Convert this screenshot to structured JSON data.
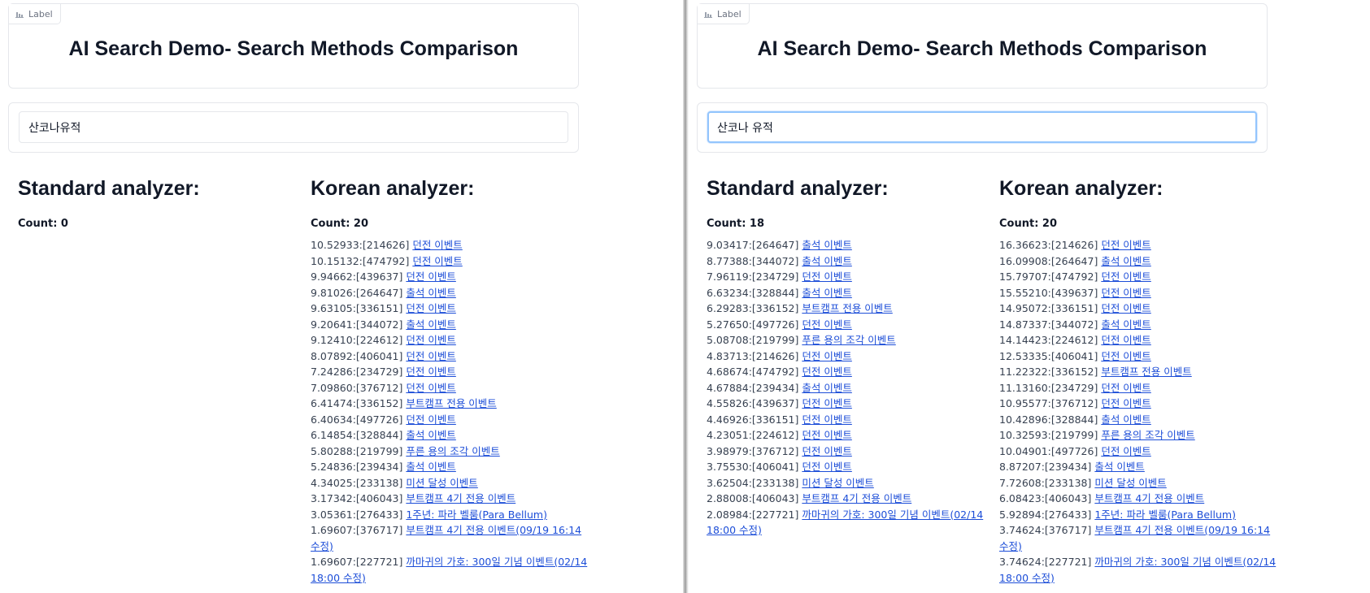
{
  "label_chip": "Label",
  "title": "AI Search Demo- Search Methods Comparison",
  "left": {
    "query": "산코나유적",
    "standard": {
      "heading": "Standard analyzer:",
      "count": "Count: 0",
      "results": []
    },
    "korean": {
      "heading": "Korean analyzer:",
      "count": "Count: 20",
      "results": [
        {
          "score": "10.52933:[214626]",
          "link": "던전 이벤트"
        },
        {
          "score": "10.15132:[474792]",
          "link": "던전 이벤트"
        },
        {
          "score": "9.94662:[439637]",
          "link": "던전 이벤트"
        },
        {
          "score": "9.81026:[264647]",
          "link": "출석 이벤트"
        },
        {
          "score": "9.63105:[336151]",
          "link": "던전 이벤트"
        },
        {
          "score": "9.20641:[344072]",
          "link": "출석 이벤트"
        },
        {
          "score": "9.12410:[224612]",
          "link": "던전 이벤트"
        },
        {
          "score": "8.07892:[406041]",
          "link": "던전 이벤트"
        },
        {
          "score": "7.24286:[234729]",
          "link": "던전 이벤트"
        },
        {
          "score": "7.09860:[376712]",
          "link": "던전 이벤트"
        },
        {
          "score": "6.41474:[336152]",
          "link": "부트캠프 전용 이벤트"
        },
        {
          "score": "6.40634:[497726]",
          "link": "던전 이벤트"
        },
        {
          "score": "6.14854:[328844]",
          "link": "출석 이벤트"
        },
        {
          "score": "5.80288:[219799]",
          "link": "푸른 용의 조각 이벤트"
        },
        {
          "score": "5.24836:[239434]",
          "link": "출석 이벤트"
        },
        {
          "score": "4.34025:[233138]",
          "link": "미션 달성 이벤트"
        },
        {
          "score": "3.17342:[406043]",
          "link": "부트캠프 4기 전용 이벤트"
        },
        {
          "score": "3.05361:[276433]",
          "link": "1주년: 파라 벨룸(Para Bellum)"
        },
        {
          "score": "1.69607:[376717]",
          "link": "부트캠프 4기 전용 이벤트(09/19 16:14 수정)"
        },
        {
          "score": "1.69607:[227721]",
          "link": "까마귀의 가호: 300일 기념 이벤트(02/14 18:00 수정)"
        }
      ]
    }
  },
  "right": {
    "query": "산코나 유적",
    "standard": {
      "heading": "Standard analyzer:",
      "count": "Count: 18",
      "results": [
        {
          "score": "9.03417:[264647]",
          "link": "출석 이벤트"
        },
        {
          "score": "8.77388:[344072]",
          "link": "출석 이벤트"
        },
        {
          "score": "7.96119:[234729]",
          "link": "던전 이벤트"
        },
        {
          "score": "6.63234:[328844]",
          "link": "출석 이벤트"
        },
        {
          "score": "6.29283:[336152]",
          "link": "부트캠프 전용 이벤트"
        },
        {
          "score": "5.27650:[497726]",
          "link": "던전 이벤트"
        },
        {
          "score": "5.08708:[219799]",
          "link": "푸른 용의 조각 이벤트"
        },
        {
          "score": "4.83713:[214626]",
          "link": "던전 이벤트"
        },
        {
          "score": "4.68674:[474792]",
          "link": "던전 이벤트"
        },
        {
          "score": "4.67884:[239434]",
          "link": "출석 이벤트"
        },
        {
          "score": "4.55826:[439637]",
          "link": "던전 이벤트"
        },
        {
          "score": "4.46926:[336151]",
          "link": "던전 이벤트"
        },
        {
          "score": "4.23051:[224612]",
          "link": "던전 이벤트"
        },
        {
          "score": "3.98979:[376712]",
          "link": "던전 이벤트"
        },
        {
          "score": "3.75530:[406041]",
          "link": "던전 이벤트"
        },
        {
          "score": "3.62504:[233138]",
          "link": "미션 달성 이벤트"
        },
        {
          "score": "2.88008:[406043]",
          "link": "부트캠프 4기 전용 이벤트"
        },
        {
          "score": "2.08984:[227721]",
          "link": "까마귀의 가호: 300일 기념 이벤트(02/14 18:00 수정)"
        }
      ]
    },
    "korean": {
      "heading": "Korean analyzer:",
      "count": "Count: 20",
      "results": [
        {
          "score": "16.36623:[214626]",
          "link": "던전 이벤트"
        },
        {
          "score": "16.09908:[264647]",
          "link": "출석 이벤트"
        },
        {
          "score": "15.79707:[474792]",
          "link": "던전 이벤트"
        },
        {
          "score": "15.55210:[439637]",
          "link": "던전 이벤트"
        },
        {
          "score": "14.95072:[336151]",
          "link": "던전 이벤트"
        },
        {
          "score": "14.87337:[344072]",
          "link": "출석 이벤트"
        },
        {
          "score": "14.14423:[224612]",
          "link": "던전 이벤트"
        },
        {
          "score": "12.53335:[406041]",
          "link": "던전 이벤트"
        },
        {
          "score": "11.22322:[336152]",
          "link": "부트캠프 전용 이벤트"
        },
        {
          "score": "11.13160:[234729]",
          "link": "던전 이벤트"
        },
        {
          "score": "10.95577:[376712]",
          "link": "던전 이벤트"
        },
        {
          "score": "10.42896:[328844]",
          "link": "출석 이벤트"
        },
        {
          "score": "10.32593:[219799]",
          "link": "푸른 용의 조각 이벤트"
        },
        {
          "score": "10.04901:[497726]",
          "link": "던전 이벤트"
        },
        {
          "score": "8.87207:[239434]",
          "link": "출석 이벤트"
        },
        {
          "score": "7.72608:[233138]",
          "link": "미션 달성 이벤트"
        },
        {
          "score": "6.08423:[406043]",
          "link": "부트캠프 4기 전용 이벤트"
        },
        {
          "score": "5.92894:[276433]",
          "link": "1주년: 파라 벨룸(Para Bellum)"
        },
        {
          "score": "3.74624:[376717]",
          "link": "부트캠프 4기 전용 이벤트(09/19 16:14 수정)"
        },
        {
          "score": "3.74624:[227721]",
          "link": "까마귀의 가호: 300일 기념 이벤트(02/14 18:00 수정)"
        }
      ]
    }
  }
}
